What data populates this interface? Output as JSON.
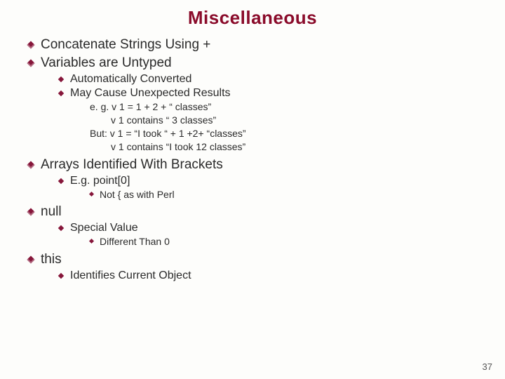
{
  "title": "Miscellaneous",
  "bullets": {
    "b1": "Concatenate Strings Using +",
    "b2": "Variables are Untyped",
    "b2_1": "Automatically Converted",
    "b2_2": "May Cause Unexpected Results",
    "b2_2_1": "e. g.  v 1 = 1 + 2 + “ classes”",
    "b2_2_2": "v 1 contains “ 3 classes”",
    "b2_2_3": "But:  v 1 = “I took “ + 1 +2+ “classes”",
    "b2_2_4": "v 1 contains “I took 12 classes”",
    "b3": "Arrays Identified With Brackets",
    "b3_1": "E.g. point[0]",
    "b3_1_1": "Not { as with Perl",
    "b4": "null",
    "b4_1": "Special Value",
    "b4_1_1": "Different Than 0",
    "b5": "this",
    "b5_1": "Identifies Current Object"
  },
  "slide_number": "37"
}
